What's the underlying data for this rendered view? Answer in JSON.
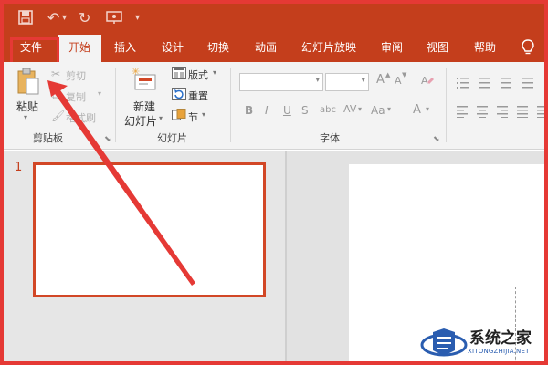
{
  "qat": {
    "save_icon": "save-icon",
    "undo_icon": "undo-icon",
    "redo_icon": "redo-icon",
    "present_icon": "present-icon",
    "customize_icon": "customize-qat-icon"
  },
  "tabs": [
    "文件",
    "开始",
    "插入",
    "设计",
    "切换",
    "动画",
    "幻灯片放映",
    "审阅",
    "视图",
    "帮助"
  ],
  "ribbon": {
    "clipboard": {
      "paste": "粘贴",
      "cut": "剪切",
      "copy": "复制",
      "format_painter": "格式刷",
      "label": "剪贴板"
    },
    "slides": {
      "new_slide_line1": "新建",
      "new_slide_line2": "幻灯片",
      "layout": "版式",
      "reset": "重置",
      "section": "节",
      "label": "幻灯片"
    },
    "font": {
      "label": "字体",
      "bold": "B",
      "italic": "I",
      "underline": "U",
      "strike": "S",
      "shadow": "abc",
      "spacing": "AV",
      "case": "Aa",
      "color": "A",
      "grow": "A",
      "shrink": "A"
    }
  },
  "slides": {
    "number": "1"
  },
  "watermark": {
    "title": "系统之家",
    "subtitle": "XITONGZHIJIA.NET"
  },
  "colors": {
    "accent": "#c43e1c",
    "annotation": "#e53935"
  }
}
